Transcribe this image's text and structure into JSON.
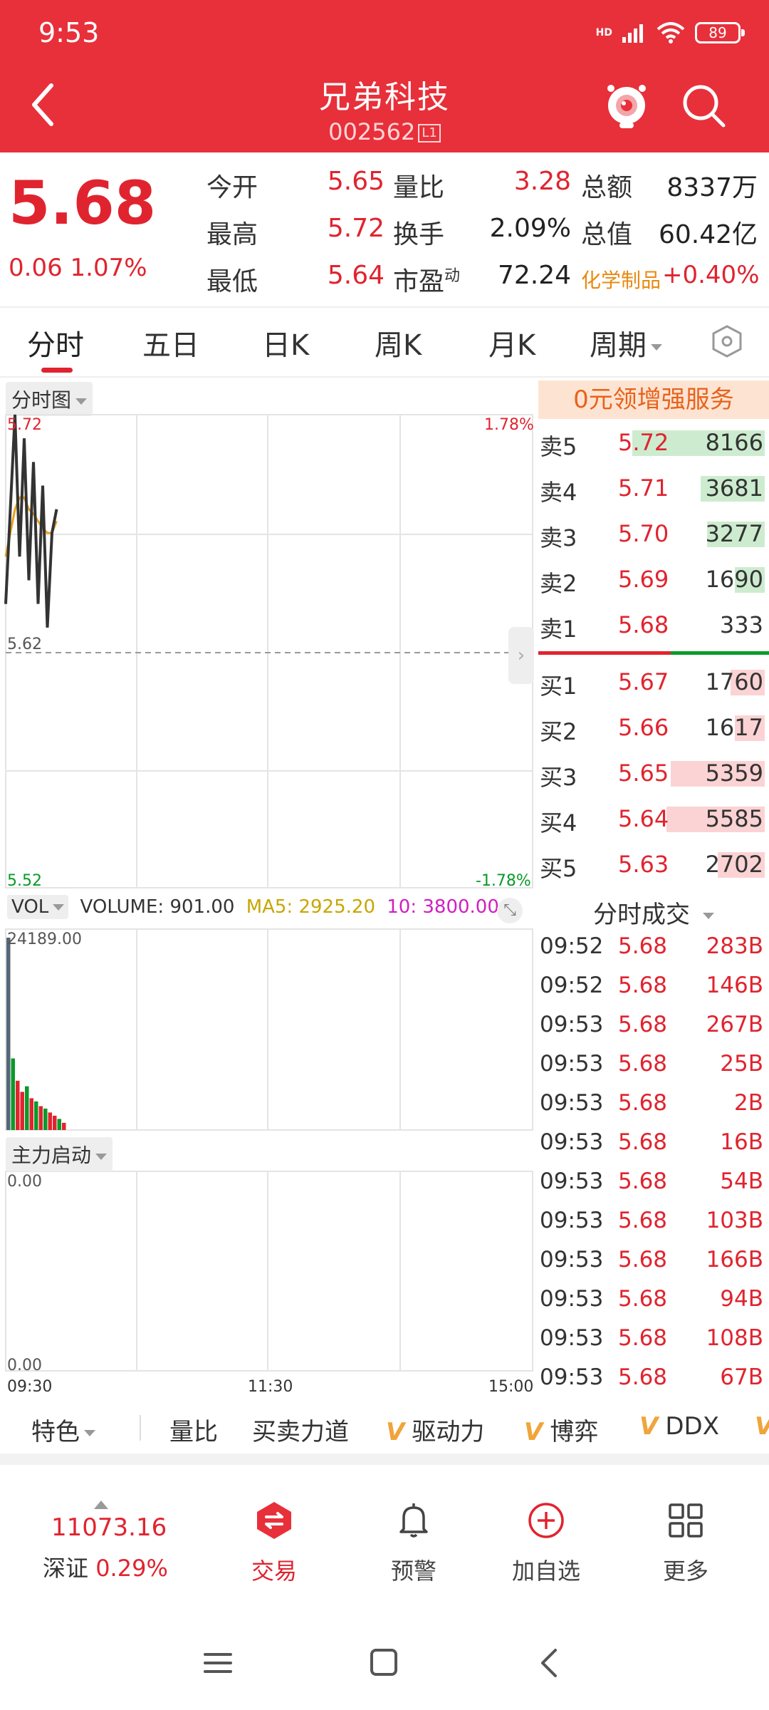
{
  "status": {
    "time": "9:53",
    "network": "HD",
    "battery": "89"
  },
  "header": {
    "title": "兄弟科技",
    "code": "002562",
    "level": "L1"
  },
  "quote": {
    "price": "5.68",
    "change": "0.06",
    "change_pct": "1.07%",
    "fields": [
      {
        "label": "今开",
        "value": "5.65"
      },
      {
        "label": "最高",
        "value": "5.72"
      },
      {
        "label": "最低",
        "value": "5.64"
      },
      {
        "label": "量比",
        "value": "3.28"
      },
      {
        "label": "换手",
        "value": "2.09%"
      },
      {
        "label": "市盈",
        "label_sup": "动",
        "value": "72.24"
      },
      {
        "label": "总额",
        "value": "8337万"
      },
      {
        "label": "总值",
        "value": "60.42亿"
      }
    ],
    "sector": {
      "name": "化学制品",
      "change": "+0.40%"
    }
  },
  "tabs": [
    "分时",
    "五日",
    "日K",
    "周K",
    "月K",
    "周期"
  ],
  "intraday": {
    "label": "分时图",
    "price_high": "5.72",
    "price_mid": "5.62",
    "price_low": "5.52",
    "pct_high": "1.78%",
    "pct_low": "-1.78%",
    "time_axis": [
      "09:30",
      "11:30",
      "15:00"
    ]
  },
  "volume_panel": {
    "label": "VOL",
    "volume_text": "VOLUME: 901.00",
    "ma5_text": "MA5: 2925.20",
    "ma10_text": "10: 3800.00",
    "max_label": "24189.00"
  },
  "main_force": {
    "label": "主力启动",
    "top_value": "0.00",
    "bottom_value": "0.00"
  },
  "order_book": {
    "promo": "0元领增强服务",
    "asks": [
      {
        "label": "卖5",
        "price": "5.72",
        "volume": "8166",
        "fill": 0.62
      },
      {
        "label": "卖4",
        "price": "5.71",
        "volume": "3681",
        "fill": 0.3
      },
      {
        "label": "卖3",
        "price": "5.70",
        "volume": "3277",
        "fill": 0.27
      },
      {
        "label": "卖2",
        "price": "5.69",
        "volume": "1690",
        "fill": 0.14
      },
      {
        "label": "卖1",
        "price": "5.68",
        "volume": "333",
        "fill": 0.0
      }
    ],
    "bids": [
      {
        "label": "买1",
        "price": "5.67",
        "volume": "1760",
        "fill": 0.16
      },
      {
        "label": "买2",
        "price": "5.66",
        "volume": "1617",
        "fill": 0.14
      },
      {
        "label": "买3",
        "price": "5.65",
        "volume": "5359",
        "fill": 0.44
      },
      {
        "label": "买4",
        "price": "5.64",
        "volume": "5585",
        "fill": 0.46
      },
      {
        "label": "买5",
        "price": "5.63",
        "volume": "2702",
        "fill": 0.22
      }
    ]
  },
  "ticks": {
    "title": "分时成交",
    "rows": [
      {
        "time": "09:52",
        "price": "5.68",
        "volume": "283B"
      },
      {
        "time": "09:52",
        "price": "5.68",
        "volume": "146B"
      },
      {
        "time": "09:53",
        "price": "5.68",
        "volume": "267B"
      },
      {
        "time": "09:53",
        "price": "5.68",
        "volume": "25B"
      },
      {
        "time": "09:53",
        "price": "5.68",
        "volume": "2B"
      },
      {
        "time": "09:53",
        "price": "5.68",
        "volume": "16B"
      },
      {
        "time": "09:53",
        "price": "5.68",
        "volume": "54B"
      },
      {
        "time": "09:53",
        "price": "5.68",
        "volume": "103B"
      },
      {
        "time": "09:53",
        "price": "5.68",
        "volume": "166B"
      },
      {
        "time": "09:53",
        "price": "5.68",
        "volume": "94B"
      },
      {
        "time": "09:53",
        "price": "5.68",
        "volume": "108B"
      },
      {
        "time": "09:53",
        "price": "5.68",
        "volume": "67B"
      }
    ]
  },
  "indicators": {
    "special": "特色",
    "items": [
      "量比",
      "买卖力道",
      "驱动力",
      "博弈",
      "DDX"
    ]
  },
  "bottom_nav": {
    "index_value": "11073.16",
    "index_name": "深证",
    "index_change": "0.29%",
    "items": [
      "交易",
      "预警",
      "加自选",
      "更多"
    ]
  },
  "colors": {
    "header": "#e8303a",
    "up": "#e0242f",
    "down": "#0a9a2a",
    "avg_line": "#e8a020",
    "price_line": "#333333"
  },
  "chart_data": [
    {
      "type": "line",
      "title": "分时图",
      "series": [
        {
          "values": [
            5.64,
            5.68,
            5.72,
            5.66,
            5.71,
            5.65,
            5.7,
            5.64,
            5.69,
            5.63,
            5.67,
            5.68
          ]
        },
        {
          "values": [
            5.66,
            5.67,
            5.68,
            5.685,
            5.685,
            5.68,
            5.678,
            5.675,
            5.672,
            5.67,
            5.67,
            5.675
          ]
        }
      ],
      "ylim": [
        5.52,
        5.72
      ]
    },
    {
      "type": "bar",
      "title": "VOL",
      "values": [
        24189,
        9000,
        6200,
        4800,
        5500,
        4000,
        3600,
        3000,
        2700,
        2200,
        1800,
        1400,
        901
      ],
      "up": [
        true,
        false,
        true,
        true,
        false,
        true,
        false,
        true,
        false,
        true,
        true,
        false,
        true
      ],
      "ylim": [
        0,
        24189
      ]
    }
  ]
}
